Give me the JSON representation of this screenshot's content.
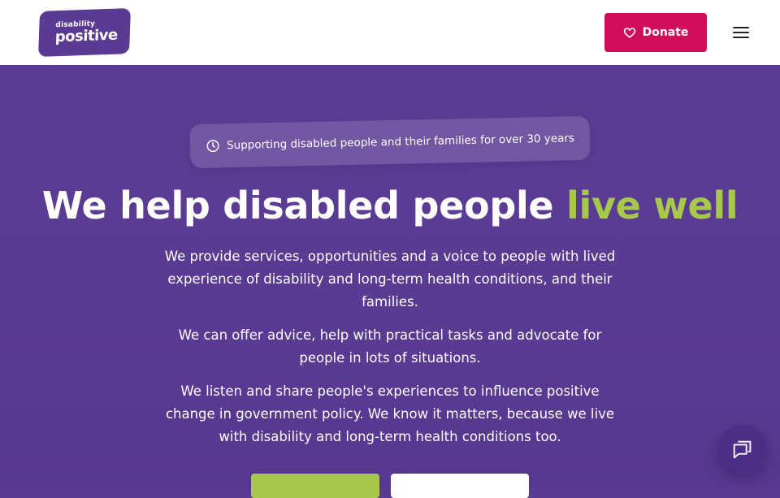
{
  "header": {
    "logo": {
      "line1": "disability",
      "line2": "positive"
    },
    "donate_label": "Donate",
    "menu_icon": "hamburger-menu-icon"
  },
  "hero": {
    "tagline": "Supporting disabled people and their families for over 30 years",
    "headline_main": "We help disabled people ",
    "headline_accent": "live well",
    "paragraphs": [
      "We provide services, opportunities and a voice to people with lived experience of disability and long-term health conditions, and their families.",
      "We can offer advice, help with practical tasks and advocate for people in lots of situations.",
      "We listen and share people's experiences to influence positive change in government policy. We know it matters, because we live with disability and long-term health conditions too."
    ]
  },
  "colors": {
    "brand_purple": "#5a3a93",
    "donate_pink": "#d10e5b",
    "accent_green": "#a8c84b",
    "chat_purple": "#4b2f86"
  },
  "icons": {
    "donate": "heart-icon",
    "tagline": "clock-icon",
    "chat": "chat-icon"
  }
}
